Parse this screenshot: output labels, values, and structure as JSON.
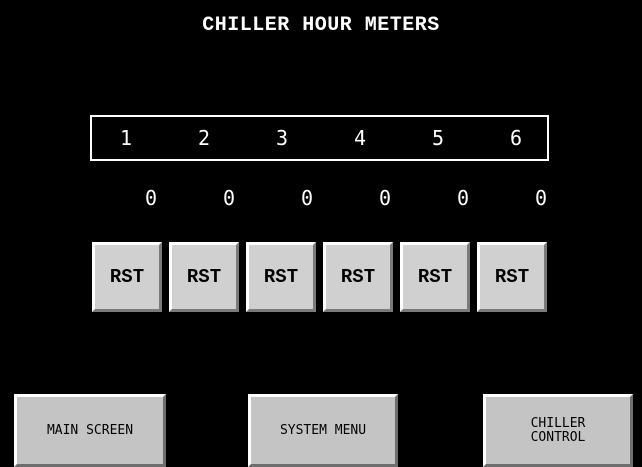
{
  "screen": {
    "title": "CHILLER HOUR METERS"
  },
  "chillers": [
    {
      "number": "1",
      "hours": "0",
      "reset_label": "RST"
    },
    {
      "number": "2",
      "hours": "0",
      "reset_label": "RST"
    },
    {
      "number": "3",
      "hours": "0",
      "reset_label": "RST"
    },
    {
      "number": "4",
      "hours": "0",
      "reset_label": "RST"
    },
    {
      "number": "5",
      "hours": "0",
      "reset_label": "RST"
    },
    {
      "number": "6",
      "hours": "0",
      "reset_label": "RST"
    }
  ],
  "nav": {
    "main_screen": "MAIN SCREEN",
    "system_menu": "SYSTEM MENU",
    "chiller_control": "CHILLER\nCONTROL"
  },
  "colors": {
    "background": "#000000",
    "text": "#ffffff",
    "button_face": "#d0d0d0"
  }
}
